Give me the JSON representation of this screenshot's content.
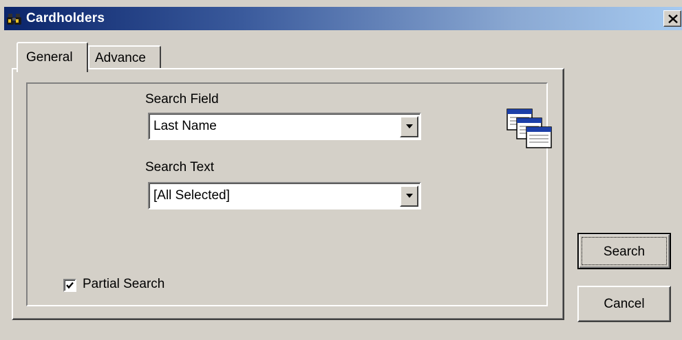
{
  "window": {
    "title": "Cardholders",
    "title_icon": "binoculars-icon",
    "close_icon": "close-icon"
  },
  "tabs": [
    {
      "label": "General",
      "selected": true
    },
    {
      "label": "Advance",
      "selected": false
    }
  ],
  "general": {
    "search_field_label": "Search Field",
    "search_field_value": "Last Name",
    "search_text_label": "Search Text",
    "search_text_value": "[All Selected]",
    "partial_search_label": "Partial Search",
    "partial_search_checked": true,
    "decor_icon": "stacked-windows-icon"
  },
  "buttons": {
    "search_label": "Search",
    "cancel_label": "Cancel"
  },
  "colors": {
    "title_bar_start": "#0a246a",
    "title_bar_end": "#a6caf0",
    "face": "#d4d0c8"
  }
}
